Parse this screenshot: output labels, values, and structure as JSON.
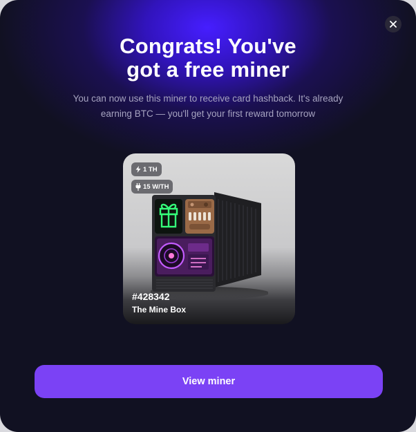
{
  "modal": {
    "title_line1": "Congrats! You've",
    "title_line2": "got a free miner",
    "subtitle": "You can now use this miner to receive card hashback. It's already earning BTC — you'll get your first reward tomorrow",
    "close_icon": "close-icon"
  },
  "miner_card": {
    "hashrate_badge": "1 TH",
    "hashrate_icon": "lightning-icon",
    "efficiency_badge": "15 W/TH",
    "efficiency_icon": "plug-icon",
    "id": "#428342",
    "name": "The Mine Box"
  },
  "actions": {
    "view_label": "View miner"
  },
  "colors": {
    "accent": "#7b42f5",
    "background": "#111122",
    "glow": "#4a1eff"
  }
}
